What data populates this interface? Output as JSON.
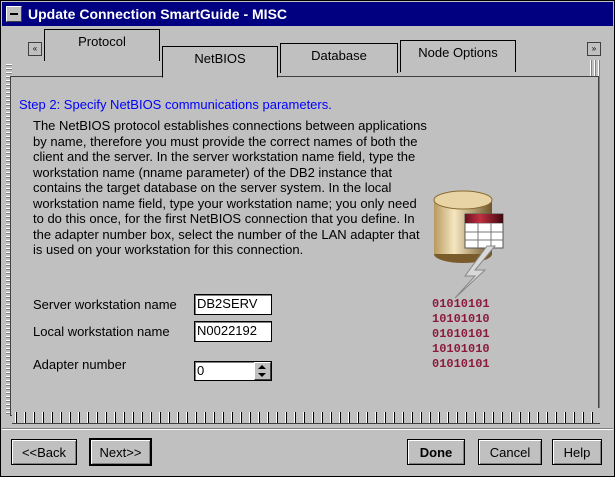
{
  "window": {
    "title": "Update Connection SmartGuide - MISC"
  },
  "tabs": [
    {
      "label": "Protocol",
      "active": false
    },
    {
      "label": "NetBIOS",
      "active": true
    },
    {
      "label": "Database",
      "active": false
    },
    {
      "label": "Node Options",
      "active": false
    }
  ],
  "page": {
    "step": "Step 2: Specify NetBIOS communications parameters.",
    "description": "The NetBIOS protocol establishes connections between applications by name, therefore you must provide the correct names of both the client and the server.  In the server workstation name field, type the workstation name (nname parameter) of the DB2 instance that contains the target database on the server system.   In the local workstation name field, type your workstation name; you only need to do this once, for the first NetBIOS connection that you define.  In the adapter number box, select the number of the LAN adapter that is used on your workstation for this connection."
  },
  "form": {
    "server_label": "Server workstation name",
    "server_value": "DB2SERV",
    "local_label": "Local workstation name",
    "local_value": "N0022192",
    "adapter_label": "Adapter number",
    "adapter_value": "0"
  },
  "illustration": {
    "binary_rows": [
      "01010101",
      "10101010",
      "01010101",
      "10101010",
      "01010101"
    ]
  },
  "buttons": {
    "back": "<<Back",
    "next": "Next>>",
    "done": "Done",
    "cancel": "Cancel",
    "help": "Help"
  },
  "colors": {
    "title_bar": "#000080",
    "step_text": "#0000ff",
    "binary": "#8b1a3c",
    "background": "#c0c0c0"
  }
}
